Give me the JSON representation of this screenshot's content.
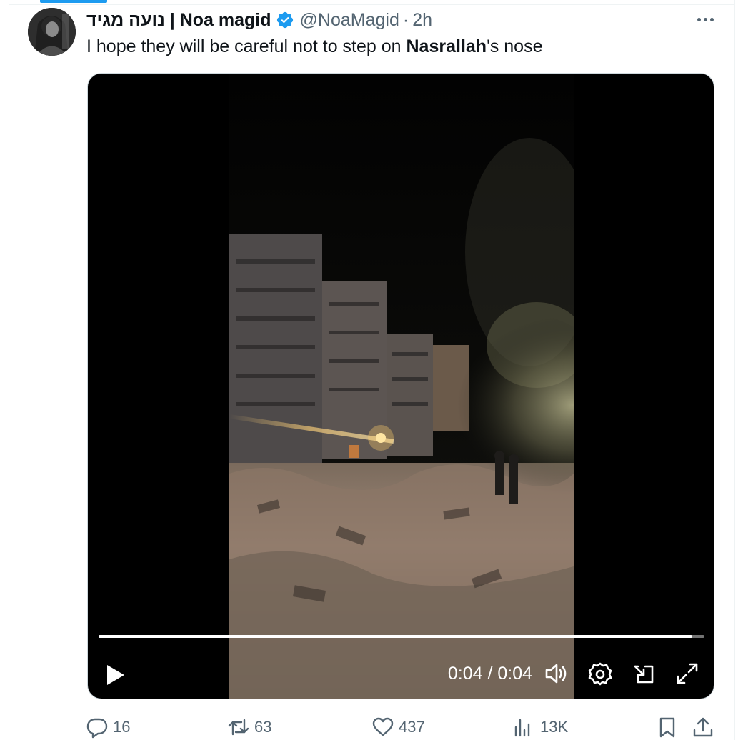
{
  "author": {
    "display_name": "נועה מגיד | Noa magid",
    "handle": "@NoaMagid",
    "separator": "·",
    "time": "2h"
  },
  "tweet": {
    "text_before": "I hope they will be careful not to step on ",
    "text_bold": "Nasrallah",
    "text_after": "'s nose"
  },
  "video": {
    "timecode": "0:04 / 0:04",
    "progress_fraction": 0.98
  },
  "actions": {
    "replies": "16",
    "reposts": "63",
    "likes": "437",
    "views": "13K"
  },
  "colors": {
    "accent": "#1d9bf0",
    "text_primary": "#0f1419",
    "text_secondary": "#536471"
  },
  "icons": [
    "verified-badge-icon",
    "more-icon",
    "play-icon",
    "volume-icon",
    "settings-icon",
    "minimize-icon",
    "fullscreen-icon",
    "reply-icon",
    "repost-icon",
    "like-icon",
    "views-icon",
    "bookmark-icon",
    "share-icon"
  ]
}
